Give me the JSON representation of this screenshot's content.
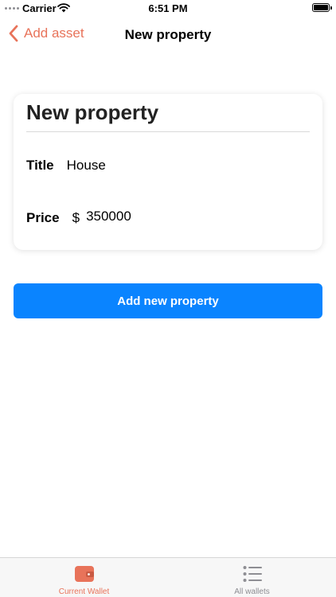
{
  "status_bar": {
    "carrier": "Carrier",
    "time": "6:51 PM"
  },
  "nav": {
    "back_label": "Add asset",
    "title": "New property"
  },
  "card": {
    "title": "New property",
    "fields": {
      "title": {
        "label": "Title",
        "value": "House"
      },
      "price": {
        "label": "Price",
        "currency": "$",
        "value": "350000"
      }
    }
  },
  "actions": {
    "add_label": "Add new property"
  },
  "tabs": [
    {
      "label": "Current Wallet",
      "icon": "wallet-icon",
      "active": true
    },
    {
      "label": "All wallets",
      "icon": "list-icon",
      "active": false
    }
  ],
  "colors": {
    "accent": "#e8735a",
    "primary": "#0a84ff",
    "inactive": "#8e8e93"
  }
}
